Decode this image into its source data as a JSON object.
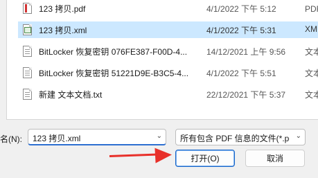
{
  "files": [
    {
      "name": "123 拷贝.pdf",
      "date": "4/1/2022 下午 5:12",
      "type": "PDF 文",
      "icon": "pdf-file-icon",
      "selected": false
    },
    {
      "name": "123 拷贝.xml",
      "date": "4/1/2022 下午 5:31",
      "type": "XML",
      "icon": "xml-file-icon",
      "selected": true
    },
    {
      "name": "BitLocker 恢复密钥 076FE387-F00D-4...",
      "date": "14/12/2021 上午 9:56",
      "type": "文本文",
      "icon": "text-file-icon",
      "selected": false
    },
    {
      "name": "BitLocker 恢复密钥 51221D9E-B3C5-4...",
      "date": "4/1/2022 下午 5:51",
      "type": "文本文",
      "icon": "text-file-icon",
      "selected": false
    },
    {
      "name": "新建 文本文档.txt",
      "date": "22/12/2021 下午 5:37",
      "type": "文本文",
      "icon": "text-file-icon",
      "selected": false
    }
  ],
  "filename_label": "名(N):",
  "filename_value": "123 拷贝.xml",
  "filter_value": "所有包含 PDF 信息的文件(*.pd",
  "open_label": "打开(O)",
  "cancel_label": "取消",
  "colors": {
    "selection": "#cce8ff",
    "arrow": "#e8302a",
    "accent": "#1a66c9"
  }
}
